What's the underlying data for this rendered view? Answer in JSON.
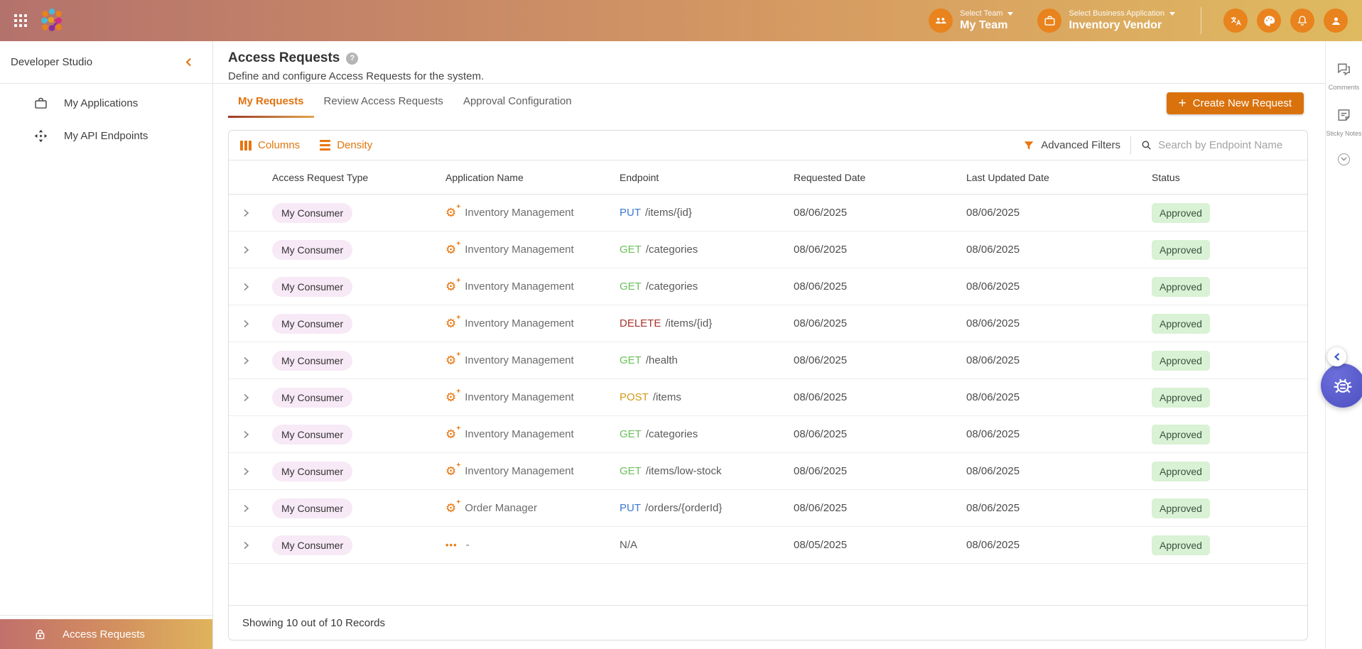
{
  "navbar": {
    "team_selector": {
      "label": "Select Team",
      "value": "My Team",
      "icon": "team-icon"
    },
    "business_selector": {
      "label": "Select Business Application",
      "value": "Inventory Vendor",
      "icon": "briefcase-icon"
    },
    "action_icons": [
      "translate-icon",
      "palette-icon",
      "notifications-icon",
      "profile-icon"
    ]
  },
  "sidebar": {
    "title": "Developer Studio",
    "items": [
      {
        "label": "My Applications",
        "icon": "briefcase-icon"
      },
      {
        "label": "My API Endpoints",
        "icon": "api-endpoints-icon"
      }
    ],
    "bottom_item": {
      "label": "Access Requests",
      "icon": "lock-icon"
    }
  },
  "page": {
    "title": "Access Requests",
    "subtitle": "Define and configure Access Requests for the system.",
    "tabs": [
      {
        "label": "My Requests",
        "active": true
      },
      {
        "label": "Review Access Requests",
        "active": false
      },
      {
        "label": "Approval Configuration",
        "active": false
      }
    ],
    "create_button_label": "Create New Request"
  },
  "toolbar": {
    "columns_label": "Columns",
    "density_label": "Density",
    "advanced_filters_label": "Advanced Filters",
    "search_placeholder": "Search by Endpoint Name"
  },
  "table": {
    "columns": [
      "Access Request Type",
      "Application Name",
      "Endpoint",
      "Requested Date",
      "Last Updated Date",
      "Status"
    ],
    "rows": [
      {
        "type": "My Consumer",
        "app_icon": "gear-icon",
        "app": "Inventory Management",
        "method": "PUT",
        "path": "/items/{id}",
        "requested": "08/06/2025",
        "updated": "08/06/2025",
        "status": "Approved"
      },
      {
        "type": "My Consumer",
        "app_icon": "gear-icon",
        "app": "Inventory Management",
        "method": "GET",
        "path": "/categories",
        "requested": "08/06/2025",
        "updated": "08/06/2025",
        "status": "Approved"
      },
      {
        "type": "My Consumer",
        "app_icon": "gear-icon",
        "app": "Inventory Management",
        "method": "GET",
        "path": "/categories",
        "requested": "08/06/2025",
        "updated": "08/06/2025",
        "status": "Approved"
      },
      {
        "type": "My Consumer",
        "app_icon": "gear-icon",
        "app": "Inventory Management",
        "method": "DELETE",
        "path": "/items/{id}",
        "requested": "08/06/2025",
        "updated": "08/06/2025",
        "status": "Approved"
      },
      {
        "type": "My Consumer",
        "app_icon": "gear-icon",
        "app": "Inventory Management",
        "method": "GET",
        "path": "/health",
        "requested": "08/06/2025",
        "updated": "08/06/2025",
        "status": "Approved"
      },
      {
        "type": "My Consumer",
        "app_icon": "gear-icon",
        "app": "Inventory Management",
        "method": "POST",
        "path": "/items",
        "requested": "08/06/2025",
        "updated": "08/06/2025",
        "status": "Approved"
      },
      {
        "type": "My Consumer",
        "app_icon": "gear-icon",
        "app": "Inventory Management",
        "method": "GET",
        "path": "/categories",
        "requested": "08/06/2025",
        "updated": "08/06/2025",
        "status": "Approved"
      },
      {
        "type": "My Consumer",
        "app_icon": "gear-icon",
        "app": "Inventory Management",
        "method": "GET",
        "path": "/items/low-stock",
        "requested": "08/06/2025",
        "updated": "08/06/2025",
        "status": "Approved"
      },
      {
        "type": "My Consumer",
        "app_icon": "gear-icon",
        "app": "Order Manager",
        "method": "PUT",
        "path": "/orders/{orderId}",
        "requested": "08/06/2025",
        "updated": "08/06/2025",
        "status": "Approved"
      },
      {
        "type": "My Consumer",
        "app_icon": "ellipsis-icon",
        "app": "-",
        "method": "N/A",
        "path": "",
        "requested": "08/05/2025",
        "updated": "08/06/2025",
        "status": "Approved"
      }
    ],
    "footer": "Showing 10 out of 10 Records"
  },
  "right_rail": {
    "items": [
      {
        "label": "Comments",
        "icon": "comments-icon"
      },
      {
        "label": "Sticky Notes",
        "icon": "sticky-notes-icon"
      }
    ],
    "floating": [
      "collapse-chevron-icon",
      "bug-report-icon"
    ]
  },
  "colors": {
    "navbar_gradient": [
      "#b4726c",
      "#d89f61",
      "#dfba60"
    ],
    "accent_orange": "#e0730f",
    "button_orange": "#d9720d",
    "badge_bg": "#f7e9f6",
    "status_approved_bg": "#d9f1d4",
    "status_approved_text": "#3d5240",
    "methods": {
      "GET": "#6abf5a",
      "PUT": "#3b78d4",
      "DELETE": "#a8352c",
      "POST": "#d2991c",
      "N/A": "#5f5f5f"
    }
  }
}
